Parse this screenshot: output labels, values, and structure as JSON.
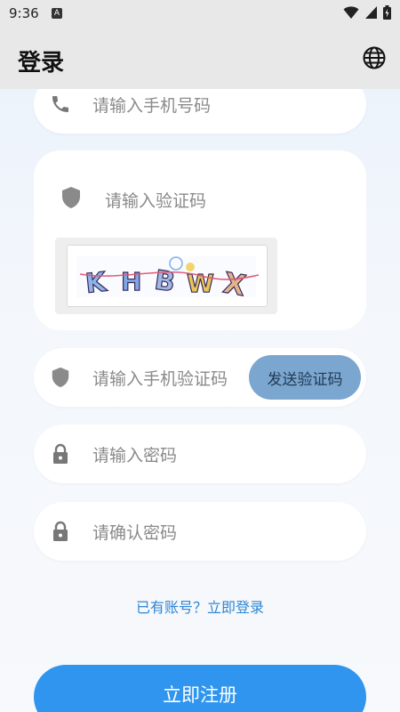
{
  "status_bar": {
    "time": "9:36",
    "notification_letter": "A"
  },
  "app_bar": {
    "title": "登录"
  },
  "form": {
    "phone_placeholder": "请输入手机号码",
    "captcha_placeholder": "请输入验证码",
    "captcha_image_text": "KHBWX",
    "sms_code_placeholder": "请输入手机验证码",
    "send_code_label": "发送验证码",
    "password_placeholder": "请输入密码",
    "confirm_password_placeholder": "请确认密码"
  },
  "login_link": "已有账号？立即登录",
  "register_button": "立即注册",
  "colors": {
    "primary": "#2f95ee",
    "send_button": "#7aa6cf",
    "link": "#2f86d4"
  }
}
